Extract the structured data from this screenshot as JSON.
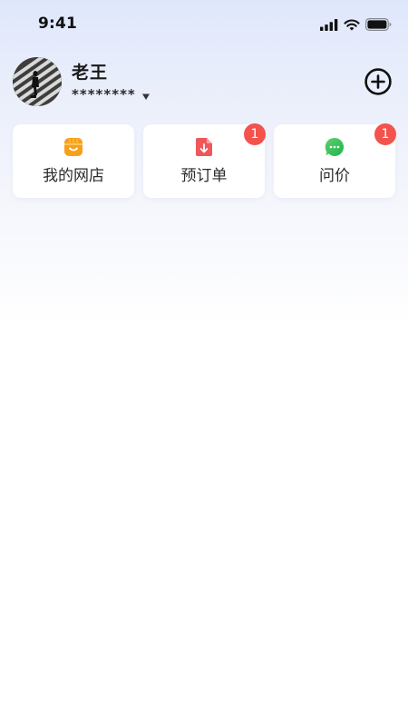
{
  "status_bar": {
    "time": "9:41",
    "icons": [
      "cellular-signal-icon",
      "wifi-icon",
      "battery-icon"
    ]
  },
  "profile": {
    "name": "老王",
    "account_mask": "********",
    "avatar_icon": "avatar-photo",
    "switch_icon": "caret-down-icon",
    "add_icon": "plus-circle-icon"
  },
  "quick_entries": [
    {
      "label": "我的网店",
      "icon": "store-icon",
      "icon_color": "#f7a01b",
      "badge": null
    },
    {
      "label": "预订单",
      "icon": "order-download-icon",
      "icon_color": "#f0565a",
      "badge": "1"
    },
    {
      "label": "问价",
      "icon": "chat-bubble-icon",
      "icon_color": "#3cc55a",
      "badge": "1"
    }
  ],
  "colors": {
    "badge": "#f3534c",
    "text_primary": "#1a1a1a",
    "card_background": "#ffffff"
  }
}
